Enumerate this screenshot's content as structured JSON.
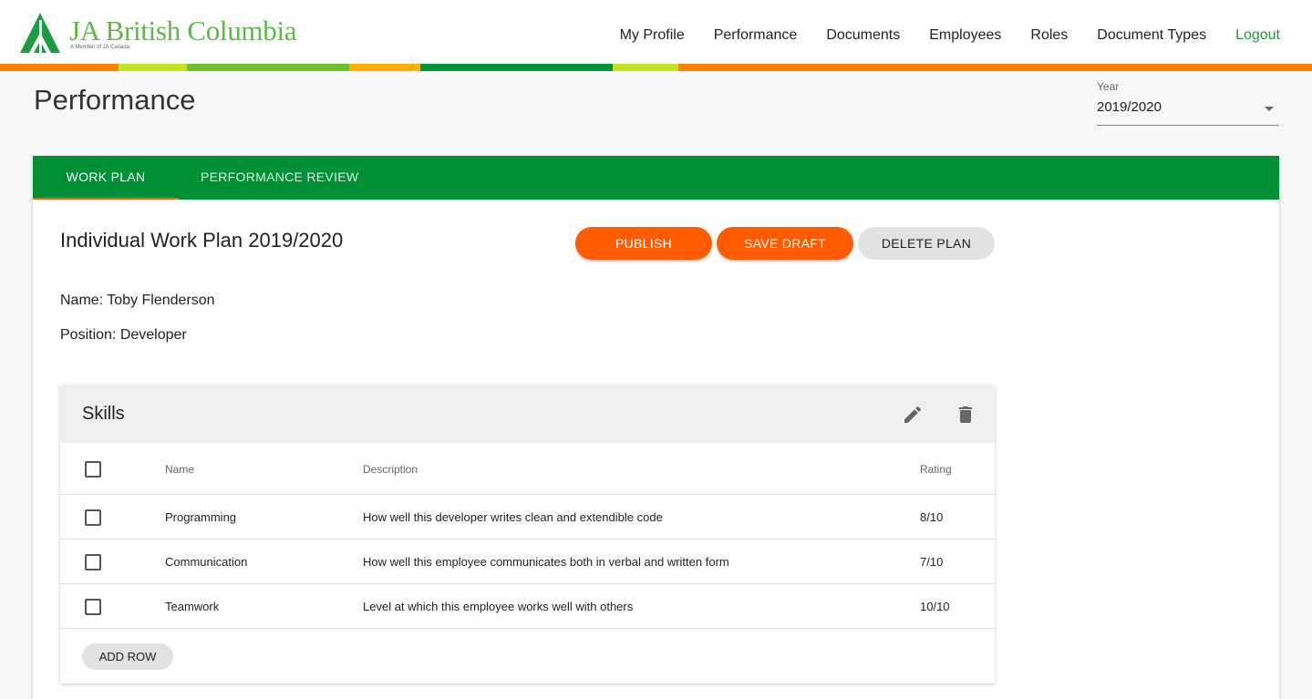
{
  "brand": {
    "title": "JA British Columbia",
    "subtitle": "A Member of JA Canada",
    "color": "#5cb946"
  },
  "nav": {
    "items": [
      {
        "label": "My Profile"
      },
      {
        "label": "Performance"
      },
      {
        "label": "Documents"
      },
      {
        "label": "Employees"
      },
      {
        "label": "Roles"
      },
      {
        "label": "Document Types"
      },
      {
        "label": "Logout"
      }
    ]
  },
  "stripe_colors": [
    "#ff8200",
    "#c5e31b",
    "#6fbe30",
    "#ffb000",
    "#00933a",
    "#c5e31b",
    "#ff8200"
  ],
  "page": {
    "title": "Performance",
    "year_label": "Year",
    "year_value": "2019/2020"
  },
  "tabs": [
    {
      "label": "WORK PLAN",
      "active": true
    },
    {
      "label": "PERFORMANCE REVIEW",
      "active": false
    }
  ],
  "plan": {
    "title": "Individual Work Plan 2019/2020",
    "publish_label": "PUBLISH",
    "save_draft_label": "SAVE DRAFT",
    "delete_label": "DELETE PLAN",
    "name_line": "Name: Toby Flenderson",
    "position_line": "Position: Developer"
  },
  "skills": {
    "title": "Skills",
    "columns": {
      "name": "Name",
      "description": "Description",
      "rating": "Rating"
    },
    "rows": [
      {
        "name": "Programming",
        "description": "How well this developer writes clean and extendible code",
        "rating": "8/10"
      },
      {
        "name": "Communication",
        "description": "How well this employee communicates both in verbal and written form",
        "rating": "7/10"
      },
      {
        "name": "Teamwork",
        "description": "Level at which this employee works well with others",
        "rating": "10/10"
      }
    ],
    "add_row_label": "ADD ROW"
  },
  "colors": {
    "accent_orange": "#ff5b00",
    "tab_green": "#009136",
    "logout_green": "#1a9b3b"
  },
  "icons": {
    "edit": "pencil-icon",
    "delete": "trash-icon",
    "logo": "ja-logo-icon"
  }
}
